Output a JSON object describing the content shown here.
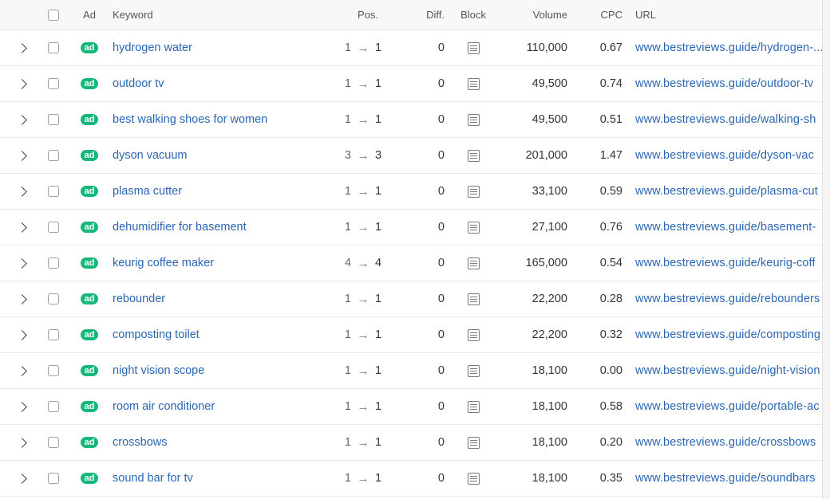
{
  "header": {
    "ad": "Ad",
    "keyword": "Keyword",
    "pos": "Pos.",
    "diff": "Diff.",
    "block": "Block",
    "volume": "Volume",
    "cpc": "CPC",
    "url": "URL"
  },
  "icons": {
    "expand": "chevron-right-icon",
    "block": "list-document-icon",
    "arrow": "arrow-right-icon"
  },
  "colors": {
    "ad_badge": "#14b87a",
    "link": "#2a66b3"
  },
  "ad_label": "ad",
  "arrow_glyph": "→",
  "rows": [
    {
      "keyword": "hydrogen water",
      "pos_from": "1",
      "pos_to": "1",
      "diff": "0",
      "volume": "110,000",
      "cpc": "0.67",
      "url": "www.bestreviews.guide/hydrogen-..."
    },
    {
      "keyword": "outdoor tv",
      "pos_from": "1",
      "pos_to": "1",
      "diff": "0",
      "volume": "49,500",
      "cpc": "0.74",
      "url": "www.bestreviews.guide/outdoor-tv"
    },
    {
      "keyword": "best walking shoes for women",
      "pos_from": "1",
      "pos_to": "1",
      "diff": "0",
      "volume": "49,500",
      "cpc": "0.51",
      "url": "www.bestreviews.guide/walking-sh"
    },
    {
      "keyword": "dyson vacuum",
      "pos_from": "3",
      "pos_to": "3",
      "diff": "0",
      "volume": "201,000",
      "cpc": "1.47",
      "url": "www.bestreviews.guide/dyson-vac"
    },
    {
      "keyword": "plasma cutter",
      "pos_from": "1",
      "pos_to": "1",
      "diff": "0",
      "volume": "33,100",
      "cpc": "0.59",
      "url": "www.bestreviews.guide/plasma-cut"
    },
    {
      "keyword": "dehumidifier for basement",
      "pos_from": "1",
      "pos_to": "1",
      "diff": "0",
      "volume": "27,100",
      "cpc": "0.76",
      "url": "www.bestreviews.guide/basement-"
    },
    {
      "keyword": "keurig coffee maker",
      "pos_from": "4",
      "pos_to": "4",
      "diff": "0",
      "volume": "165,000",
      "cpc": "0.54",
      "url": "www.bestreviews.guide/keurig-coff"
    },
    {
      "keyword": "rebounder",
      "pos_from": "1",
      "pos_to": "1",
      "diff": "0",
      "volume": "22,200",
      "cpc": "0.28",
      "url": "www.bestreviews.guide/rebounders"
    },
    {
      "keyword": "composting toilet",
      "pos_from": "1",
      "pos_to": "1",
      "diff": "0",
      "volume": "22,200",
      "cpc": "0.32",
      "url": "www.bestreviews.guide/composting"
    },
    {
      "keyword": "night vision scope",
      "pos_from": "1",
      "pos_to": "1",
      "diff": "0",
      "volume": "18,100",
      "cpc": "0.00",
      "url": "www.bestreviews.guide/night-vision"
    },
    {
      "keyword": "room air conditioner",
      "pos_from": "1",
      "pos_to": "1",
      "diff": "0",
      "volume": "18,100",
      "cpc": "0.58",
      "url": "www.bestreviews.guide/portable-ac"
    },
    {
      "keyword": "crossbows",
      "pos_from": "1",
      "pos_to": "1",
      "diff": "0",
      "volume": "18,100",
      "cpc": "0.20",
      "url": "www.bestreviews.guide/crossbows"
    },
    {
      "keyword": "sound bar for tv",
      "pos_from": "1",
      "pos_to": "1",
      "diff": "0",
      "volume": "18,100",
      "cpc": "0.35",
      "url": "www.bestreviews.guide/soundbars"
    }
  ]
}
